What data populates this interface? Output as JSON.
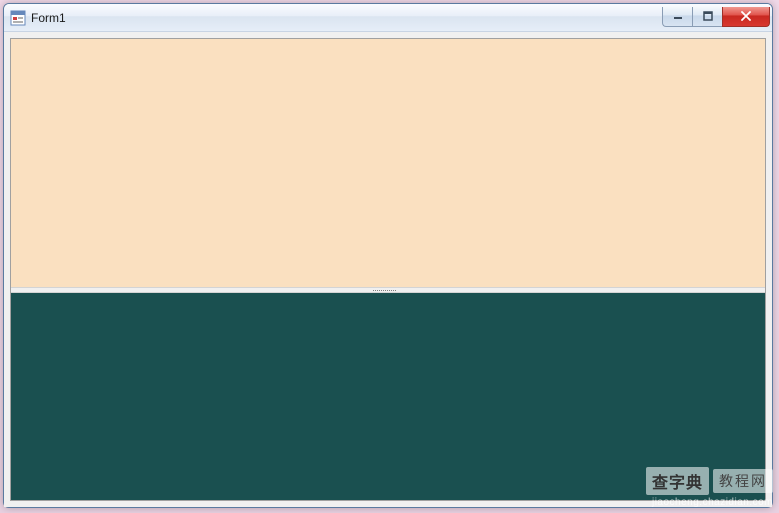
{
  "window": {
    "title": "Form1"
  },
  "panels": {
    "top_color": "#fae0c0",
    "bottom_color": "#1a5050"
  },
  "watermark": {
    "logo": "查字典",
    "sub": "教程网",
    "url": "jiaocheng.chazidian.com"
  }
}
